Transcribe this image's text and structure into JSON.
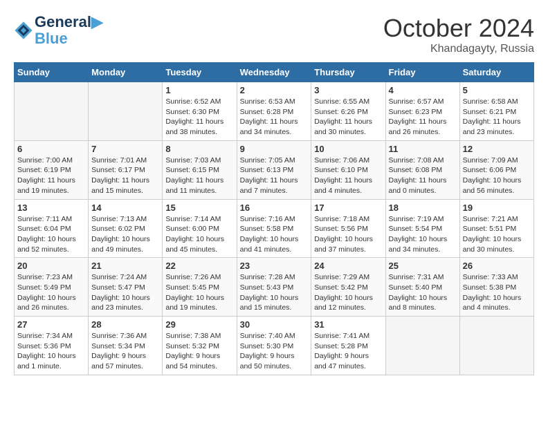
{
  "header": {
    "logo_line1": "General",
    "logo_line2": "Blue",
    "month": "October 2024",
    "location": "Khandagayty, Russia"
  },
  "columns": [
    "Sunday",
    "Monday",
    "Tuesday",
    "Wednesday",
    "Thursday",
    "Friday",
    "Saturday"
  ],
  "weeks": [
    [
      {
        "day": "",
        "empty": true
      },
      {
        "day": "",
        "empty": true
      },
      {
        "day": "1",
        "sunrise": "6:52 AM",
        "sunset": "6:30 PM",
        "daylight": "11 hours and 38 minutes."
      },
      {
        "day": "2",
        "sunrise": "6:53 AM",
        "sunset": "6:28 PM",
        "daylight": "11 hours and 34 minutes."
      },
      {
        "day": "3",
        "sunrise": "6:55 AM",
        "sunset": "6:26 PM",
        "daylight": "11 hours and 30 minutes."
      },
      {
        "day": "4",
        "sunrise": "6:57 AM",
        "sunset": "6:23 PM",
        "daylight": "11 hours and 26 minutes."
      },
      {
        "day": "5",
        "sunrise": "6:58 AM",
        "sunset": "6:21 PM",
        "daylight": "11 hours and 23 minutes."
      }
    ],
    [
      {
        "day": "6",
        "sunrise": "7:00 AM",
        "sunset": "6:19 PM",
        "daylight": "11 hours and 19 minutes."
      },
      {
        "day": "7",
        "sunrise": "7:01 AM",
        "sunset": "6:17 PM",
        "daylight": "11 hours and 15 minutes."
      },
      {
        "day": "8",
        "sunrise": "7:03 AM",
        "sunset": "6:15 PM",
        "daylight": "11 hours and 11 minutes."
      },
      {
        "day": "9",
        "sunrise": "7:05 AM",
        "sunset": "6:13 PM",
        "daylight": "11 hours and 7 minutes."
      },
      {
        "day": "10",
        "sunrise": "7:06 AM",
        "sunset": "6:10 PM",
        "daylight": "11 hours and 4 minutes."
      },
      {
        "day": "11",
        "sunrise": "7:08 AM",
        "sunset": "6:08 PM",
        "daylight": "11 hours and 0 minutes."
      },
      {
        "day": "12",
        "sunrise": "7:09 AM",
        "sunset": "6:06 PM",
        "daylight": "10 hours and 56 minutes."
      }
    ],
    [
      {
        "day": "13",
        "sunrise": "7:11 AM",
        "sunset": "6:04 PM",
        "daylight": "10 hours and 52 minutes."
      },
      {
        "day": "14",
        "sunrise": "7:13 AM",
        "sunset": "6:02 PM",
        "daylight": "10 hours and 49 minutes."
      },
      {
        "day": "15",
        "sunrise": "7:14 AM",
        "sunset": "6:00 PM",
        "daylight": "10 hours and 45 minutes."
      },
      {
        "day": "16",
        "sunrise": "7:16 AM",
        "sunset": "5:58 PM",
        "daylight": "10 hours and 41 minutes."
      },
      {
        "day": "17",
        "sunrise": "7:18 AM",
        "sunset": "5:56 PM",
        "daylight": "10 hours and 37 minutes."
      },
      {
        "day": "18",
        "sunrise": "7:19 AM",
        "sunset": "5:54 PM",
        "daylight": "10 hours and 34 minutes."
      },
      {
        "day": "19",
        "sunrise": "7:21 AM",
        "sunset": "5:51 PM",
        "daylight": "10 hours and 30 minutes."
      }
    ],
    [
      {
        "day": "20",
        "sunrise": "7:23 AM",
        "sunset": "5:49 PM",
        "daylight": "10 hours and 26 minutes."
      },
      {
        "day": "21",
        "sunrise": "7:24 AM",
        "sunset": "5:47 PM",
        "daylight": "10 hours and 23 minutes."
      },
      {
        "day": "22",
        "sunrise": "7:26 AM",
        "sunset": "5:45 PM",
        "daylight": "10 hours and 19 minutes."
      },
      {
        "day": "23",
        "sunrise": "7:28 AM",
        "sunset": "5:43 PM",
        "daylight": "10 hours and 15 minutes."
      },
      {
        "day": "24",
        "sunrise": "7:29 AM",
        "sunset": "5:42 PM",
        "daylight": "10 hours and 12 minutes."
      },
      {
        "day": "25",
        "sunrise": "7:31 AM",
        "sunset": "5:40 PM",
        "daylight": "10 hours and 8 minutes."
      },
      {
        "day": "26",
        "sunrise": "7:33 AM",
        "sunset": "5:38 PM",
        "daylight": "10 hours and 4 minutes."
      }
    ],
    [
      {
        "day": "27",
        "sunrise": "7:34 AM",
        "sunset": "5:36 PM",
        "daylight": "10 hours and 1 minute."
      },
      {
        "day": "28",
        "sunrise": "7:36 AM",
        "sunset": "5:34 PM",
        "daylight": "9 hours and 57 minutes."
      },
      {
        "day": "29",
        "sunrise": "7:38 AM",
        "sunset": "5:32 PM",
        "daylight": "9 hours and 54 minutes."
      },
      {
        "day": "30",
        "sunrise": "7:40 AM",
        "sunset": "5:30 PM",
        "daylight": "9 hours and 50 minutes."
      },
      {
        "day": "31",
        "sunrise": "7:41 AM",
        "sunset": "5:28 PM",
        "daylight": "9 hours and 47 minutes."
      },
      {
        "day": "",
        "empty": true
      },
      {
        "day": "",
        "empty": true
      }
    ]
  ]
}
